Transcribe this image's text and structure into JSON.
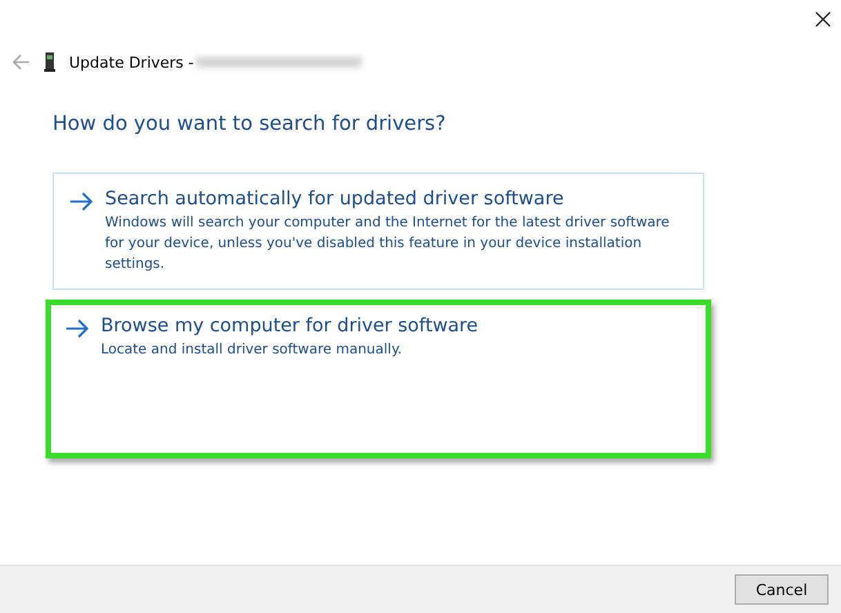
{
  "window": {
    "title": "Update Drivers -"
  },
  "heading": "How do you want to search for drivers?",
  "options": [
    {
      "title": "Search automatically for updated driver software",
      "description": "Windows will search your computer and the Internet for the latest driver software for your device, unless you've disabled this feature in your device installation settings.",
      "highlighted": false
    },
    {
      "title": "Browse my computer for driver software",
      "description": "Locate and install driver software manually.",
      "highlighted": true
    }
  ],
  "buttons": [
    "Cancel"
  ]
}
